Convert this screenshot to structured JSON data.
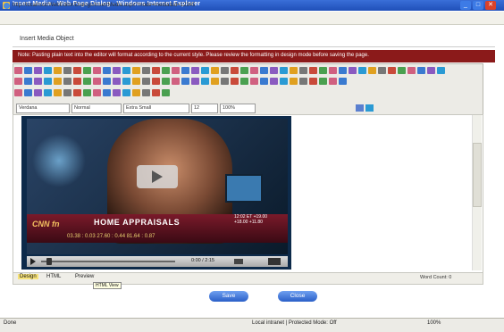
{
  "window": {
    "title": "Insert Media - Web Page Dialog - Windows Internet Explorer",
    "min_glyph": "_",
    "max_glyph": "□",
    "close_glyph": "✕"
  },
  "address": {
    "url": "http://localhost/WebEditor/Dialogs/InsertMedia.aspx?mode=media&id=12345"
  },
  "dialog": {
    "heading": "Insert Media Object"
  },
  "banner": {
    "text": "Note: Pasting plain text into the editor will format according to the current style. Please review the formatting in design mode before saving the page."
  },
  "toolbar": {
    "font_name": "Verdana",
    "font_style": "Normal",
    "font_size": "Extra Small",
    "size_value": "12",
    "zoom": "100%"
  },
  "video": {
    "logo": "CNN fn",
    "headline": "HOME APPRAISALS",
    "ticker": "03.38 : 0.03    27.60 : 0.44    81.64 : 0.87",
    "side_info": "12:02 ET  +19.00  +18.00  +11.80",
    "time": "0:00 / 2:15"
  },
  "editor_status": {
    "design": "Design",
    "html": "HTML",
    "preview": "Preview",
    "tooltip": "HTML View",
    "words": "Word Count: 0"
  },
  "buttons": {
    "save": "Save",
    "close": "Close"
  },
  "statusbar": {
    "left": "Done",
    "zone": "Local intranet | Protected Mode: Off",
    "zoom": "100%"
  },
  "colors": {
    "banner": "#8b1a1a",
    "titlebar": "#1f4fb8",
    "button": "#2a5fc8"
  }
}
